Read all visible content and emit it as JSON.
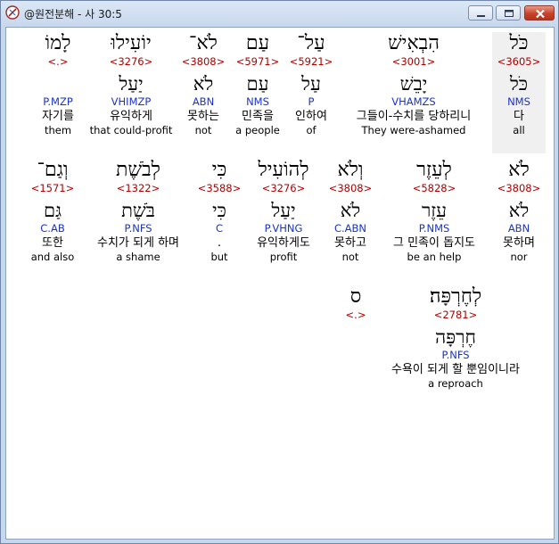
{
  "window": {
    "title": "@원전분해 - 사 30:5",
    "icon": "interlinear-app-icon"
  },
  "controls": {
    "minimize_icon": "minimize-icon",
    "maximize_icon": "maximize-icon",
    "close_icon": "close-icon"
  },
  "colors": {
    "strong": "#b00000",
    "morph": "#1a33cc",
    "text": "#000000",
    "selected_bg": "#f0f0f0"
  },
  "rows": [
    {
      "words": [
        {
          "hebrew": "כֹּל",
          "strong": "<3605>",
          "lexeme": "כֹּל",
          "morph": "NMS",
          "korean": "다",
          "english": "all",
          "selected": true
        },
        {
          "hebrew": "הִבְאִישׁ",
          "strong": "<3001>",
          "lexeme": "יָבֵשׁ",
          "morph": "VHAMZS",
          "korean": "그들이-수치를 당하리니",
          "english": "They were-ashamed"
        },
        {
          "hebrew": "עַל־",
          "strong": "<5921>",
          "lexeme": "עַל",
          "morph": "P",
          "korean": "인하여",
          "english": "of"
        },
        {
          "hebrew": "עַם",
          "strong": "<5971>",
          "lexeme": "עַם",
          "morph": "NMS",
          "korean": "민족을",
          "english": "a people"
        },
        {
          "hebrew": "לֹא־",
          "strong": "<3808>",
          "lexeme": "לֹא",
          "morph": "ABN",
          "korean": "못하는",
          "english": "not"
        },
        {
          "hebrew": "יוֹעִילוּ",
          "strong": "<3276>",
          "lexeme": "יַעַל",
          "morph": "VHIMZP",
          "korean": "유익하게",
          "english": "that could-profit"
        },
        {
          "hebrew": "לָמוֹ",
          "strong": "<.>",
          "lexeme": "",
          "morph": "P.MZP",
          "korean": "자기를",
          "english": "them"
        }
      ]
    },
    {
      "words": [
        {
          "hebrew": "לֹא",
          "strong": "<3808>",
          "lexeme": "לֹא",
          "morph": "ABN",
          "korean": "못하며",
          "english": "nor"
        },
        {
          "hebrew": "לְעֵזֶר",
          "strong": "<5828>",
          "lexeme": "עֵזֶר",
          "morph": "P.NMS",
          "korean": "그 민족이 돕지도",
          "english": "be an help"
        },
        {
          "hebrew": "וְלֹא",
          "strong": "<3808>",
          "lexeme": "לֹא",
          "morph": "C.ABN",
          "korean": "못하고",
          "english": "not"
        },
        {
          "hebrew": "לְהוֹעִיל",
          "strong": "<3276>",
          "lexeme": "יַעַל",
          "morph": "P.VHNG",
          "korean": "유익하게도",
          "english": "profit"
        },
        {
          "hebrew": "כִּי",
          "strong": "<3588>",
          "lexeme": "כִּי",
          "morph": "C",
          "korean": ".",
          "english": "but"
        },
        {
          "hebrew": "לְבֹשֶׁת",
          "strong": "<1322>",
          "lexeme": "בֹּשֶׁת",
          "morph": "P.NFS",
          "korean": "수치가 되게 하며",
          "english": "a shame"
        },
        {
          "hebrew": "וְגַם־",
          "strong": "<1571>",
          "lexeme": "גַּם",
          "morph": "C.AB",
          "korean": "또한",
          "english": "and also"
        }
      ]
    },
    {
      "words": [
        {
          "hebrew": "לְחֶרְפָּה׃",
          "strong": "<2781>",
          "lexeme": "חֶרְפָּה",
          "morph": "P.NFS",
          "korean": "수욕이 되게 할 뿐임이니라",
          "english": "a reproach"
        },
        {
          "hebrew": "ס",
          "strong": "<.>",
          "lexeme": "",
          "morph": "",
          "korean": "",
          "english": ""
        }
      ]
    }
  ]
}
